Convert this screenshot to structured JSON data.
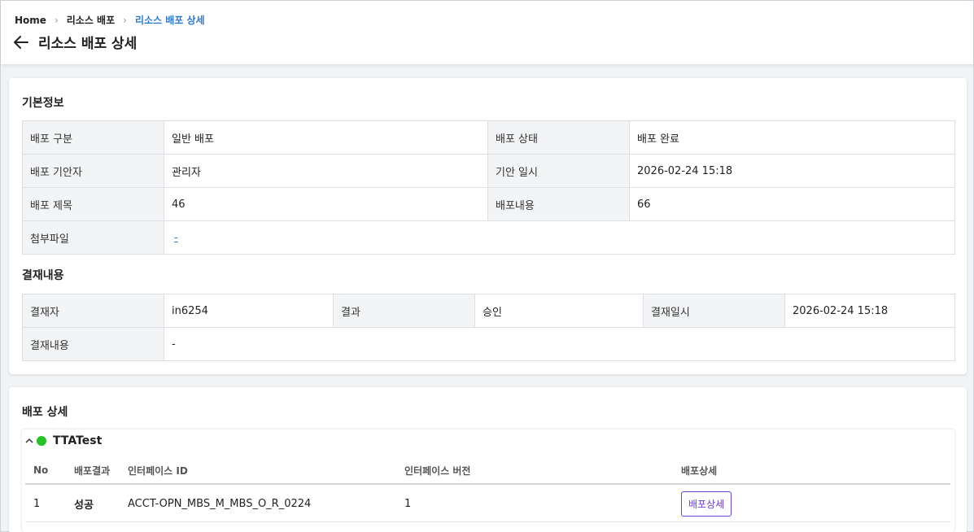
{
  "breadcrumb": {
    "home": "Home",
    "level1": "리소스 배포",
    "current": "리소스 배포 상세"
  },
  "page": {
    "title": "리소스 배포 상세"
  },
  "basic_info": {
    "title": "기본정보",
    "type_label": "배포 구분",
    "type_value": "일반 배포",
    "status_label": "배포 상태",
    "status_value": "배포 완료",
    "drafter_label": "배포 기안자",
    "drafter_value": "관리자",
    "draft_date_label": "기안 일시",
    "draft_date_value": "2026-02-24 15:18",
    "subject_label": "배포 제목",
    "subject_value": "46",
    "content_label": "배포내용",
    "content_value": "66",
    "attachment_label": "첨부파일",
    "attachment_value": "-"
  },
  "approval": {
    "title": "결재내용",
    "approver_label": "결재자",
    "approver_value": "in6254",
    "result_label": "결과",
    "result_value": "승인",
    "date_label": "결재일시",
    "date_value": "2026-02-24 15:18",
    "comment_label": "결재내용",
    "comment_value": "-"
  },
  "deploy_detail": {
    "title": "배포 상세",
    "group": {
      "name": "TTATest",
      "status_color": "#22c322",
      "columns": {
        "no": "No",
        "result": "배포결과",
        "interface_id": "인터페이스 ID",
        "interface_version": "인터페이스 버전",
        "detail": "배포상세"
      },
      "rows": [
        {
          "no": "1",
          "result": "성공",
          "interface_id": "ACCT-OPN_MBS_M_MBS_O_R_0224",
          "interface_version": "1",
          "detail_button": "배포상세"
        }
      ]
    }
  }
}
